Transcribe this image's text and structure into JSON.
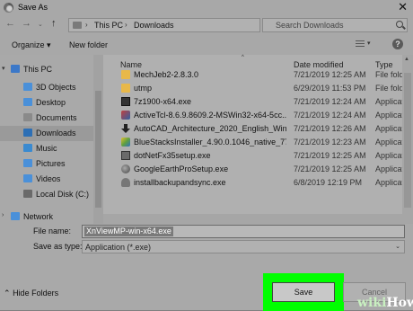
{
  "window": {
    "title": "Save As",
    "close": "✕"
  },
  "address": {
    "crumbs": [
      "This PC",
      "Downloads"
    ],
    "separator": "›"
  },
  "search": {
    "placeholder": "Search Downloads"
  },
  "toolbar": {
    "organize": "Organize ▾",
    "new_folder": "New folder"
  },
  "nav": {
    "items": [
      {
        "label": "This PC",
        "icon": "computer-icon",
        "color": "#3c78c8"
      },
      {
        "label": "3D Objects",
        "icon": "cube-icon",
        "color": "#4a90d9"
      },
      {
        "label": "Desktop",
        "icon": "desktop-icon",
        "color": "#4a90d9"
      },
      {
        "label": "Documents",
        "icon": "document-icon",
        "color": "#8a8a8a"
      },
      {
        "label": "Downloads",
        "icon": "download-icon",
        "color": "#2d6fb5"
      },
      {
        "label": "Music",
        "icon": "music-icon",
        "color": "#3a8ad0"
      },
      {
        "label": "Pictures",
        "icon": "pictures-icon",
        "color": "#4a90d9"
      },
      {
        "label": "Videos",
        "icon": "video-icon",
        "color": "#4a90d9"
      },
      {
        "label": "Local Disk (C:)",
        "icon": "disk-icon",
        "color": "#6a6a6a"
      },
      {
        "label": "Network",
        "icon": "network-icon",
        "color": "#4a90d9"
      }
    ]
  },
  "columns": {
    "name": "Name",
    "date": "Date modified",
    "type": "Type"
  },
  "files": [
    {
      "name": "MechJeb2-2.8.3.0",
      "date": "7/21/2019 12:25 AM",
      "type": "File folder",
      "icon": "folder-icon"
    },
    {
      "name": "utmp",
      "date": "6/29/2019 11:53 PM",
      "type": "File folder",
      "icon": "folder-icon"
    },
    {
      "name": "7z1900-x64.exe",
      "date": "7/21/2019 12:24 AM",
      "type": "Application",
      "icon": "installer-icon"
    },
    {
      "name": "ActiveTcl-8.6.9.8609.2-MSWin32-x64-5cc...",
      "date": "7/21/2019 12:24 AM",
      "type": "Application",
      "icon": "feather-icon"
    },
    {
      "name": "AutoCAD_Architecture_2020_English_Win...",
      "date": "7/21/2019 12:26 AM",
      "type": "Application",
      "icon": "install-arrow-icon"
    },
    {
      "name": "BlueStacksInstaller_4.90.0.1046_native_77...",
      "date": "7/21/2019 12:23 AM",
      "type": "Application",
      "icon": "bluestacks-icon"
    },
    {
      "name": "dotNetFx35setup.exe",
      "date": "7/21/2019 12:25 AM",
      "type": "Application",
      "icon": "window-icon"
    },
    {
      "name": "GoogleEarthProSetup.exe",
      "date": "7/21/2019 12:25 AM",
      "type": "Application",
      "icon": "globe-icon"
    },
    {
      "name": "installbackupandsync.exe",
      "date": "6/8/2019 12:19 PM",
      "type": "Application",
      "icon": "cloud-icon"
    }
  ],
  "bottom": {
    "filename_label": "File name:",
    "filename_value": "XnViewMP-win-x64.exe",
    "savetype_label": "Save as type:",
    "savetype_value": "Application (*.exe)",
    "hide_folders": "Hide Folders",
    "save": "Save",
    "cancel": "Cancel"
  },
  "watermark": {
    "wiki": "wiki",
    "how": "How"
  },
  "colors": {
    "highlight": "#00ff00",
    "folder": "#e8b84a"
  }
}
